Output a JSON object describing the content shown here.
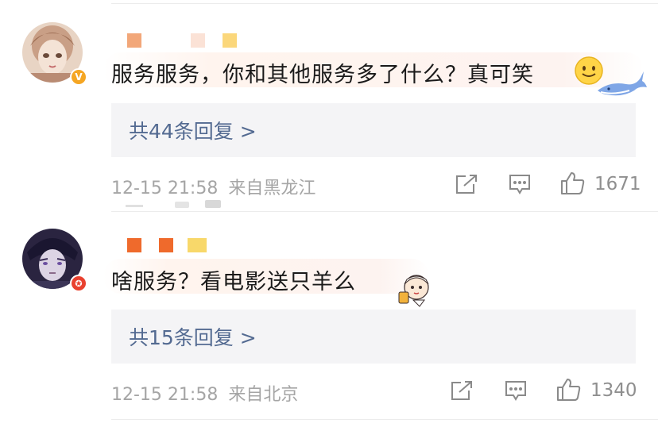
{
  "comments": [
    {
      "text": "服务服务，你和其他服务多了什么？真可笑",
      "reply_link": "共44条回复 >",
      "timestamp": "12-15 21:58",
      "location": "来自黑龙江",
      "likes": "1671",
      "badge": "V",
      "badge_color": "#f5a623"
    },
    {
      "text": "啥服务？看电影送只羊么",
      "reply_link": "共15条回复 >",
      "timestamp": "12-15 21:58",
      "location": "来自北京",
      "likes": "1340",
      "badge": "✪",
      "badge_color": "#e9412f"
    }
  ],
  "icons": [
    "share-icon",
    "comment-icon",
    "like-icon",
    "smile-emoji-icon",
    "whale-icon",
    "chibi-sticker-icon"
  ]
}
